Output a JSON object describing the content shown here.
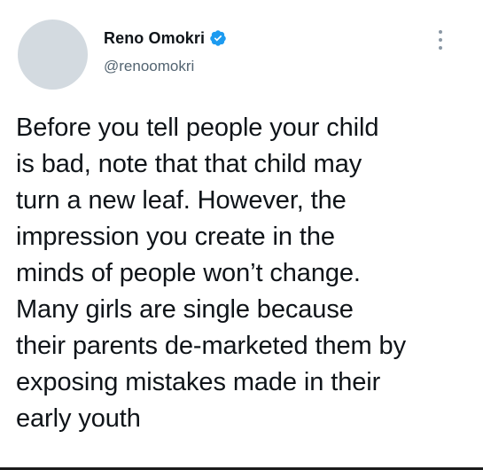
{
  "author": {
    "display_name": "Reno Omokri",
    "handle": "@renoomokri",
    "verified_icon": "verified-badge-icon",
    "verified_color": "#1d9bf0"
  },
  "menu": {
    "icon": "more-options-icon"
  },
  "tweet": {
    "lines": [
      "Before you tell people your child",
      "is bad, note that that child may",
      "turn a new leaf. However, the",
      "impression you create in the",
      "minds of people won’t change.",
      "Many girls are single because",
      "their parents de-marketed them by",
      "exposing mistakes made in their",
      "early youth"
    ]
  }
}
